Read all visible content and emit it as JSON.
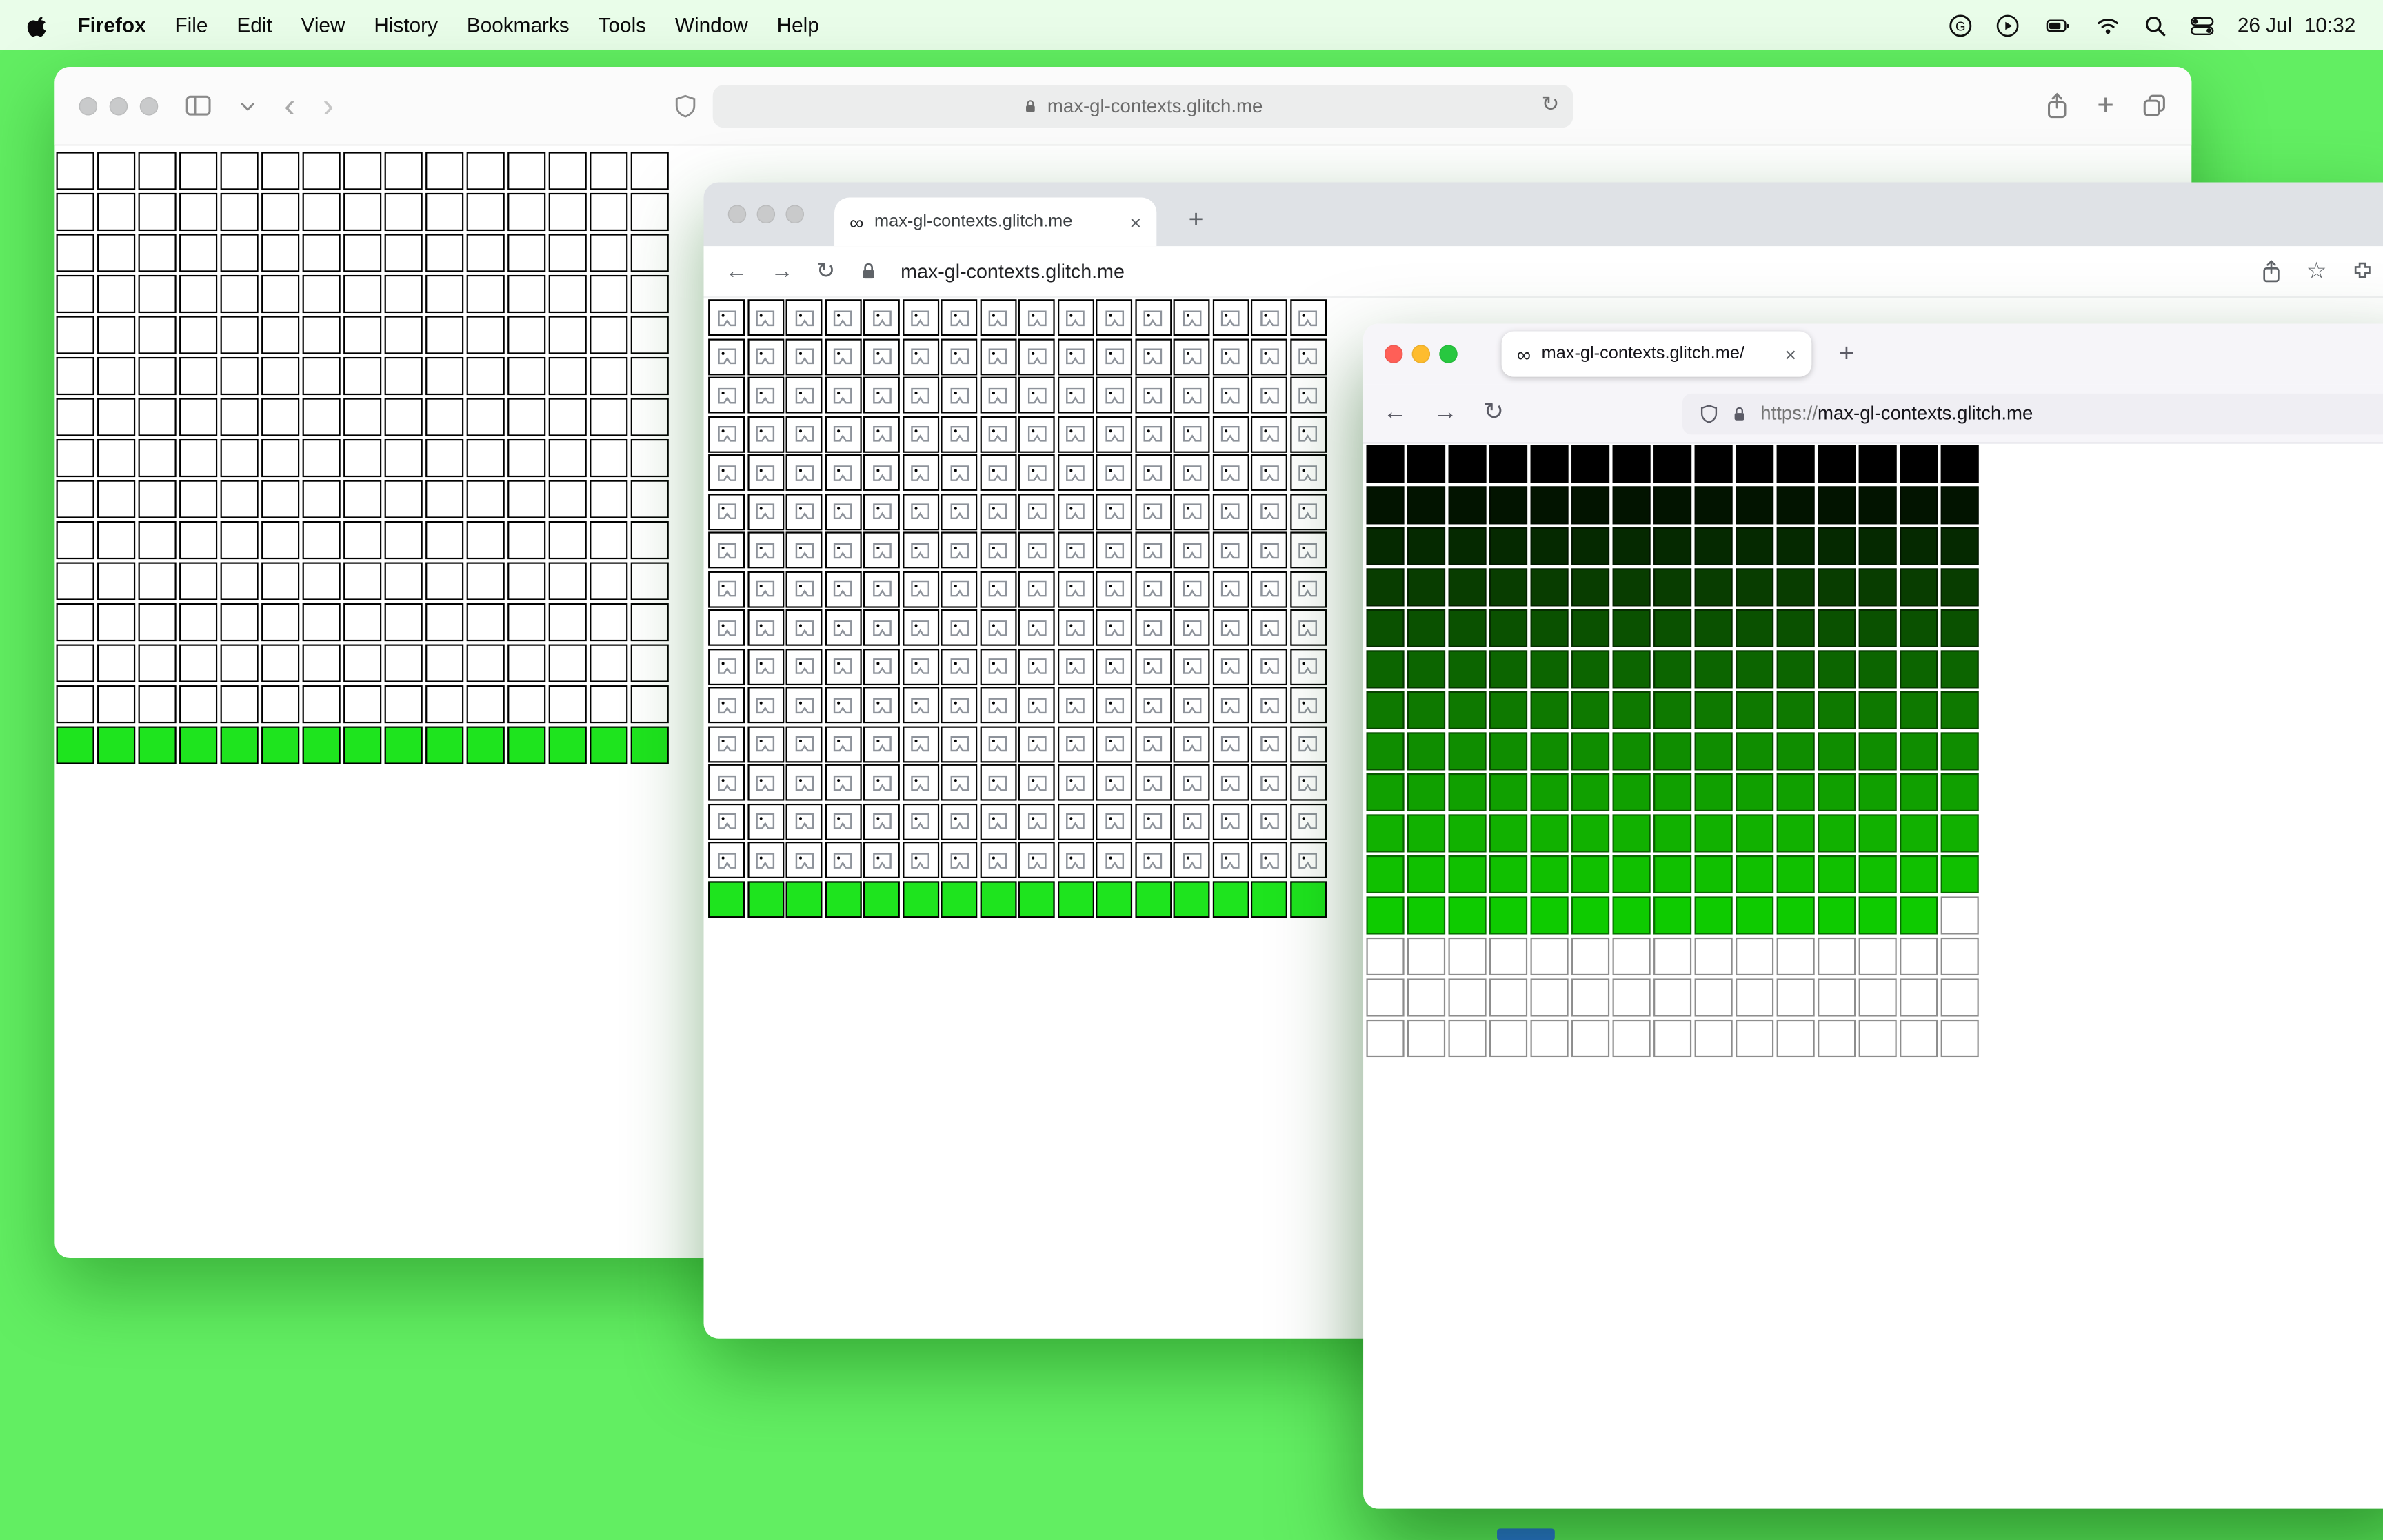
{
  "desktop": {
    "background": "#62EE62",
    "sliver_color": "#2E6FE8"
  },
  "menubar": {
    "app_name": "Firefox",
    "items": [
      "File",
      "Edit",
      "View",
      "History",
      "Bookmarks",
      "Tools",
      "Window",
      "Help"
    ],
    "date": "26 Jul",
    "time": "10:32"
  },
  "glyphs": {
    "infinity": "∞",
    "close": "×",
    "plus": "+",
    "back_chevron": "‹",
    "forward_chevron": "›",
    "back_arrow": "←",
    "forward_arrow": "→",
    "reload": "↻",
    "star": "☆"
  },
  "safari_window": {
    "url": "max-gl-contexts.glitch.me",
    "grid": {
      "cols": 15,
      "rows": 15,
      "green_row_indices": [
        14
      ],
      "green_color": "#1EE41E",
      "cell_color": "#FFFFFF"
    }
  },
  "chrome_window": {
    "tab_title": "max-gl-contexts.glitch.me",
    "url": "max-gl-contexts.glitch.me",
    "grid": {
      "cols": 16,
      "rows": 16,
      "green_row_indices": [
        15
      ],
      "green_color": "#1EE41E",
      "cell_icon": "broken-image"
    }
  },
  "firefox_window": {
    "tab_title": "max-gl-contexts.glitch.me/",
    "url_scheme": "https://",
    "url_host": "max-gl-contexts.glitch.me",
    "grid": {
      "cols": 15,
      "gradient_row_colors": [
        "#000000",
        "#021400",
        "#052900",
        "#083D00",
        "#0A5100",
        "#0C6500",
        "#0E7900",
        "#0F8D00",
        "#10A000",
        "#11B100",
        "#10C000",
        "#0ECB00"
      ],
      "white_rows": 3,
      "white_cell": {
        "row_index": 11,
        "col_index": 14
      }
    }
  }
}
